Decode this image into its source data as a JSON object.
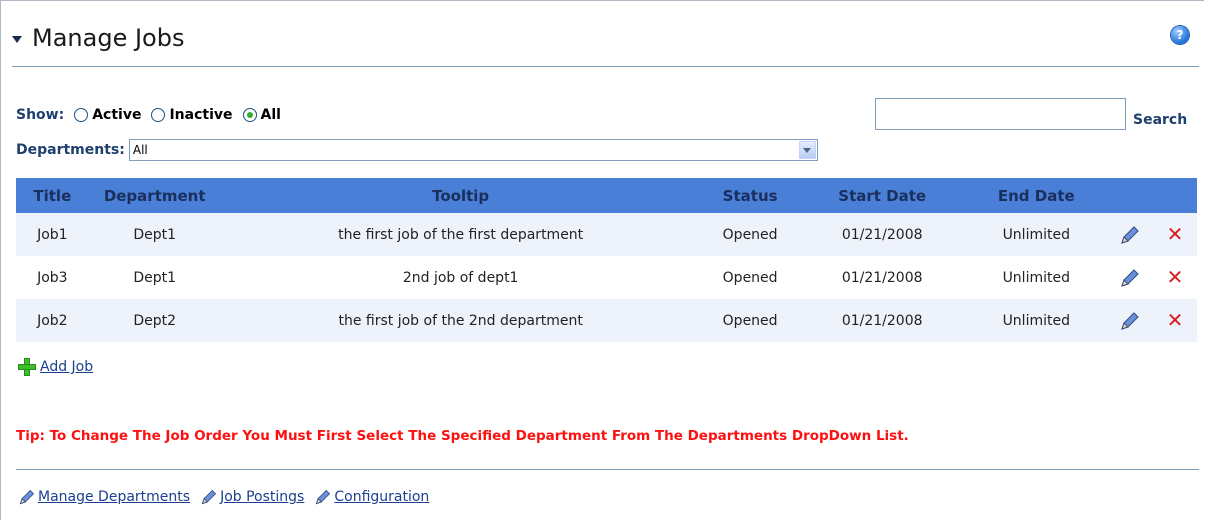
{
  "header": {
    "title": "Manage Jobs",
    "help_icon": "help-icon"
  },
  "filters": {
    "show_label": "Show:",
    "options": [
      {
        "label": "Active",
        "checked": false
      },
      {
        "label": "Inactive",
        "checked": false
      },
      {
        "label": "All",
        "checked": true
      }
    ],
    "departments_label": "Departments:",
    "departments_value": "All",
    "search_value": "",
    "search_label": "Search"
  },
  "table": {
    "columns": [
      "Title",
      "Department",
      "Tooltip",
      "Status",
      "Start Date",
      "End Date"
    ],
    "rows": [
      {
        "title": "Job1",
        "department": "Dept1",
        "tooltip": "the first job of the first department",
        "status": "Opened",
        "start": "01/21/2008",
        "end": "Unlimited"
      },
      {
        "title": "Job3",
        "department": "Dept1",
        "tooltip": "2nd job of dept1",
        "status": "Opened",
        "start": "01/21/2008",
        "end": "Unlimited"
      },
      {
        "title": "Job2",
        "department": "Dept2",
        "tooltip": "the first job of the 2nd department",
        "status": "Opened",
        "start": "01/21/2008",
        "end": "Unlimited"
      }
    ],
    "header_color": "#4a7fd8"
  },
  "actions": {
    "add_job": "Add Job"
  },
  "tip": "Tip: To Change The Job Order You Must First Select The Specified Department From The Departments DropDown List.",
  "footer": {
    "links": [
      "Manage Departments",
      "Job Postings",
      "Configuration"
    ]
  }
}
